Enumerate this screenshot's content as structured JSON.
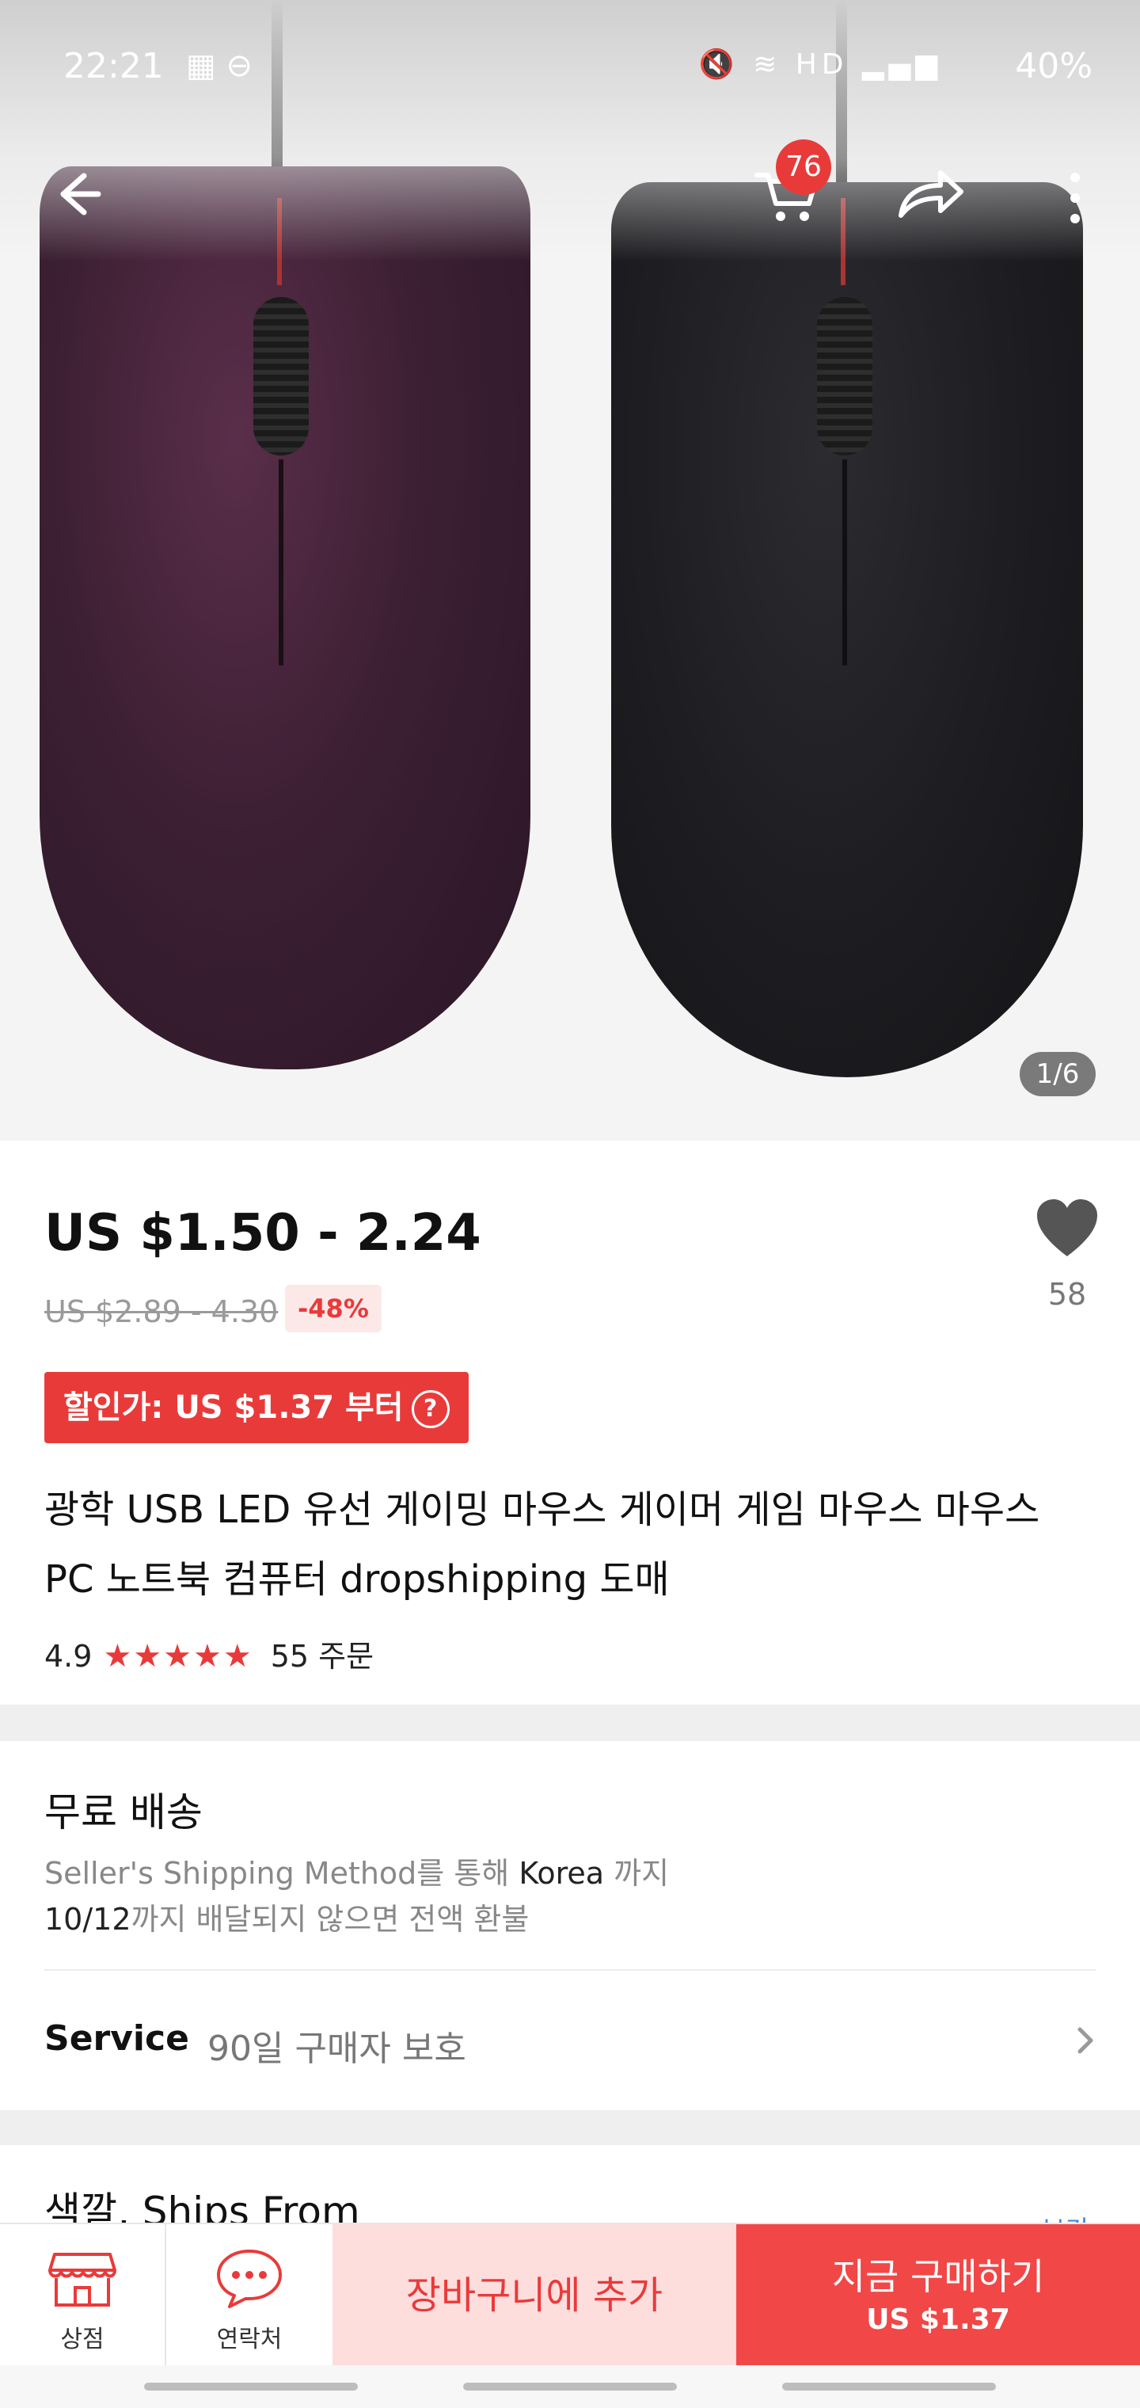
{
  "status_bar": {
    "time": "22:21",
    "network": "HD",
    "battery": "40%"
  },
  "header": {
    "cart_count": "76",
    "pager": "1/6"
  },
  "product": {
    "price": "US $1.50 - 2.24",
    "original_price": "US $2.89 - 4.30",
    "discount": "-48%",
    "wishlist_count": "58",
    "promo": "할인가: US $1.37 부터",
    "promo_help": "?",
    "title": "광학 USB LED 유선 게이밍 마우스 게이머 게임 마우스 마우스 PC 노트북 컴퓨터 dropshipping 도매",
    "rating": "4.9",
    "stars": "★★★★★",
    "orders": "55 주문"
  },
  "shipping": {
    "heading": "무료 배송",
    "line1_prefix": "Seller's Shipping Method를 통해 ",
    "line1_dest": "Korea",
    "line1_suffix": " 까지",
    "line2_date": "10/12",
    "line2_suffix": "까지 배달되지 않으면 전액 환불"
  },
  "service": {
    "label": "Service",
    "value": "90일 구매자 보호"
  },
  "next_section": {
    "heading": "색깔, Ships From",
    "link": "보기"
  },
  "bottom_bar": {
    "store_label": "상점",
    "contact_label": "연락처",
    "add_to_cart": "장바구니에 추가",
    "buy_now": "지금 구매하기",
    "buy_now_price": "US $1.37"
  },
  "colors": {
    "accent": "#e93a3a",
    "accent_soft": "#fedddd",
    "link": "#3a88d8"
  }
}
